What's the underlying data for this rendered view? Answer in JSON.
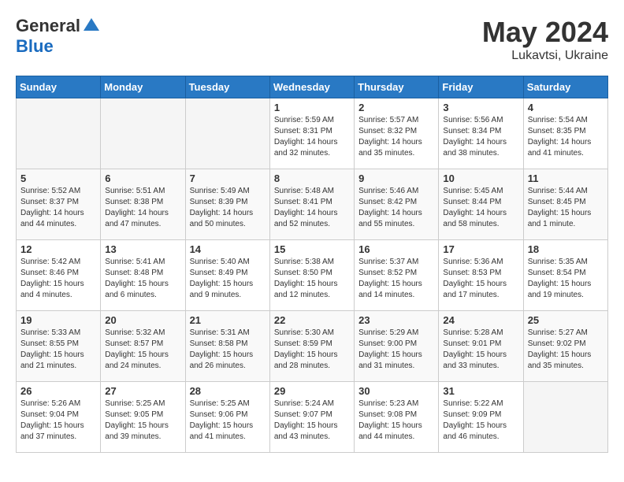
{
  "header": {
    "logo_general": "General",
    "logo_blue": "Blue",
    "month": "May 2024",
    "location": "Lukavtsi, Ukraine"
  },
  "weekdays": [
    "Sunday",
    "Monday",
    "Tuesday",
    "Wednesday",
    "Thursday",
    "Friday",
    "Saturday"
  ],
  "weeks": [
    [
      {
        "day": "",
        "info": ""
      },
      {
        "day": "",
        "info": ""
      },
      {
        "day": "",
        "info": ""
      },
      {
        "day": "1",
        "info": "Sunrise: 5:59 AM\nSunset: 8:31 PM\nDaylight: 14 hours\nand 32 minutes."
      },
      {
        "day": "2",
        "info": "Sunrise: 5:57 AM\nSunset: 8:32 PM\nDaylight: 14 hours\nand 35 minutes."
      },
      {
        "day": "3",
        "info": "Sunrise: 5:56 AM\nSunset: 8:34 PM\nDaylight: 14 hours\nand 38 minutes."
      },
      {
        "day": "4",
        "info": "Sunrise: 5:54 AM\nSunset: 8:35 PM\nDaylight: 14 hours\nand 41 minutes."
      }
    ],
    [
      {
        "day": "5",
        "info": "Sunrise: 5:52 AM\nSunset: 8:37 PM\nDaylight: 14 hours\nand 44 minutes."
      },
      {
        "day": "6",
        "info": "Sunrise: 5:51 AM\nSunset: 8:38 PM\nDaylight: 14 hours\nand 47 minutes."
      },
      {
        "day": "7",
        "info": "Sunrise: 5:49 AM\nSunset: 8:39 PM\nDaylight: 14 hours\nand 50 minutes."
      },
      {
        "day": "8",
        "info": "Sunrise: 5:48 AM\nSunset: 8:41 PM\nDaylight: 14 hours\nand 52 minutes."
      },
      {
        "day": "9",
        "info": "Sunrise: 5:46 AM\nSunset: 8:42 PM\nDaylight: 14 hours\nand 55 minutes."
      },
      {
        "day": "10",
        "info": "Sunrise: 5:45 AM\nSunset: 8:44 PM\nDaylight: 14 hours\nand 58 minutes."
      },
      {
        "day": "11",
        "info": "Sunrise: 5:44 AM\nSunset: 8:45 PM\nDaylight: 15 hours\nand 1 minute."
      }
    ],
    [
      {
        "day": "12",
        "info": "Sunrise: 5:42 AM\nSunset: 8:46 PM\nDaylight: 15 hours\nand 4 minutes."
      },
      {
        "day": "13",
        "info": "Sunrise: 5:41 AM\nSunset: 8:48 PM\nDaylight: 15 hours\nand 6 minutes."
      },
      {
        "day": "14",
        "info": "Sunrise: 5:40 AM\nSunset: 8:49 PM\nDaylight: 15 hours\nand 9 minutes."
      },
      {
        "day": "15",
        "info": "Sunrise: 5:38 AM\nSunset: 8:50 PM\nDaylight: 15 hours\nand 12 minutes."
      },
      {
        "day": "16",
        "info": "Sunrise: 5:37 AM\nSunset: 8:52 PM\nDaylight: 15 hours\nand 14 minutes."
      },
      {
        "day": "17",
        "info": "Sunrise: 5:36 AM\nSunset: 8:53 PM\nDaylight: 15 hours\nand 17 minutes."
      },
      {
        "day": "18",
        "info": "Sunrise: 5:35 AM\nSunset: 8:54 PM\nDaylight: 15 hours\nand 19 minutes."
      }
    ],
    [
      {
        "day": "19",
        "info": "Sunrise: 5:33 AM\nSunset: 8:55 PM\nDaylight: 15 hours\nand 21 minutes."
      },
      {
        "day": "20",
        "info": "Sunrise: 5:32 AM\nSunset: 8:57 PM\nDaylight: 15 hours\nand 24 minutes."
      },
      {
        "day": "21",
        "info": "Sunrise: 5:31 AM\nSunset: 8:58 PM\nDaylight: 15 hours\nand 26 minutes."
      },
      {
        "day": "22",
        "info": "Sunrise: 5:30 AM\nSunset: 8:59 PM\nDaylight: 15 hours\nand 28 minutes."
      },
      {
        "day": "23",
        "info": "Sunrise: 5:29 AM\nSunset: 9:00 PM\nDaylight: 15 hours\nand 31 minutes."
      },
      {
        "day": "24",
        "info": "Sunrise: 5:28 AM\nSunset: 9:01 PM\nDaylight: 15 hours\nand 33 minutes."
      },
      {
        "day": "25",
        "info": "Sunrise: 5:27 AM\nSunset: 9:02 PM\nDaylight: 15 hours\nand 35 minutes."
      }
    ],
    [
      {
        "day": "26",
        "info": "Sunrise: 5:26 AM\nSunset: 9:04 PM\nDaylight: 15 hours\nand 37 minutes."
      },
      {
        "day": "27",
        "info": "Sunrise: 5:25 AM\nSunset: 9:05 PM\nDaylight: 15 hours\nand 39 minutes."
      },
      {
        "day": "28",
        "info": "Sunrise: 5:25 AM\nSunset: 9:06 PM\nDaylight: 15 hours\nand 41 minutes."
      },
      {
        "day": "29",
        "info": "Sunrise: 5:24 AM\nSunset: 9:07 PM\nDaylight: 15 hours\nand 43 minutes."
      },
      {
        "day": "30",
        "info": "Sunrise: 5:23 AM\nSunset: 9:08 PM\nDaylight: 15 hours\nand 44 minutes."
      },
      {
        "day": "31",
        "info": "Sunrise: 5:22 AM\nSunset: 9:09 PM\nDaylight: 15 hours\nand 46 minutes."
      },
      {
        "day": "",
        "info": ""
      }
    ]
  ]
}
